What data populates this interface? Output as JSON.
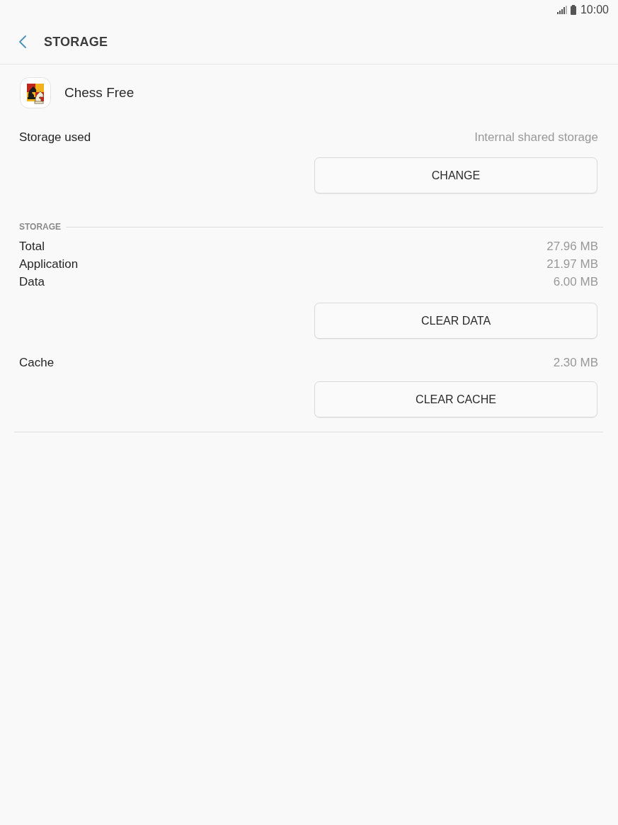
{
  "status_bar": {
    "time": "10:00"
  },
  "header": {
    "title": "STORAGE"
  },
  "app": {
    "name": "Chess Free"
  },
  "storage_used": {
    "label": "Storage used",
    "value": "Internal shared storage",
    "button": "CHANGE"
  },
  "storage": {
    "heading": "STORAGE",
    "rows": [
      {
        "label": "Total",
        "value": "27.96 MB"
      },
      {
        "label": "Application",
        "value": "21.97 MB"
      },
      {
        "label": "Data",
        "value": "6.00 MB"
      }
    ],
    "button": "CLEAR DATA"
  },
  "cache": {
    "label": "Cache",
    "value": "2.30 MB",
    "button": "CLEAR CACHE"
  }
}
